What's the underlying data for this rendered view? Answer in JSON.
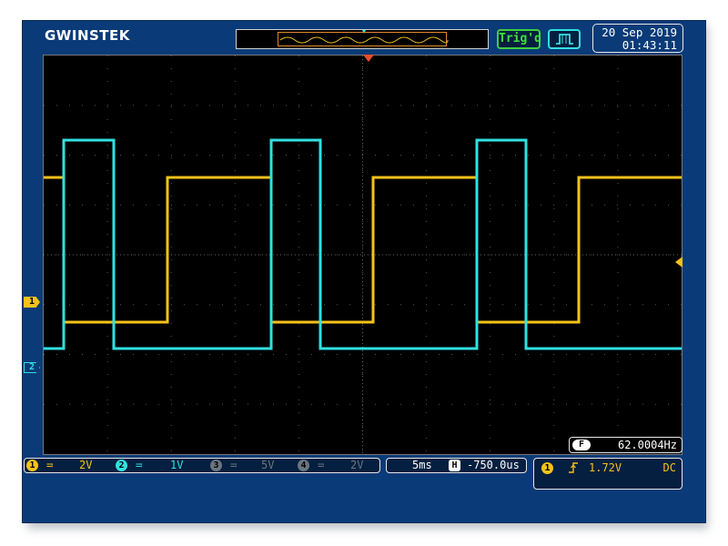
{
  "header": {
    "brand": "GWINSTEK",
    "trigger_status": "Trig'd",
    "trigger_type_icon": "rising-edge-pulse-icon",
    "date": "20 Sep 2019",
    "time": "01:43:11"
  },
  "screen": {
    "ch1_marker": "1",
    "ch2_marker": "2",
    "frequency_icon": "F",
    "frequency": "62.0004Hz"
  },
  "channels": [
    {
      "num": "1",
      "coupling": "≕",
      "scale": "2V",
      "color": "#f5c21a",
      "active": true
    },
    {
      "num": "2",
      "coupling": "≕",
      "scale": "1V",
      "color": "#31e0e0",
      "active": true
    },
    {
      "num": "3",
      "coupling": "≕",
      "scale": "5V",
      "color": "#6b7580",
      "active": false
    },
    {
      "num": "4",
      "coupling": "≕",
      "scale": "2V",
      "color": "#6b7580",
      "active": false
    }
  ],
  "timebase": {
    "time_div": "5ms",
    "horiz_icon": "H",
    "position": "-750.0us"
  },
  "trigger": {
    "source": "1",
    "slope_icon": "rising-edge-icon",
    "level": "1.72V",
    "coupling": "DC"
  },
  "colors": {
    "ch1": "#f5c21a",
    "ch2": "#31e0e0",
    "background": "#0a3b78",
    "grid": "#000000"
  }
}
